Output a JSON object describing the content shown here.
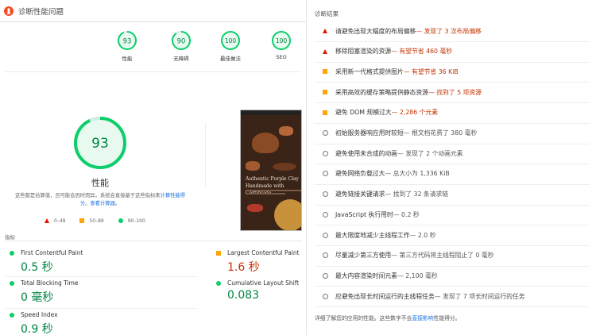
{
  "header": {
    "title": "诊断性能问题"
  },
  "gauges": [
    {
      "score": "93",
      "label": "性能"
    },
    {
      "score": "90",
      "label": "无障碍"
    },
    {
      "score": "100",
      "label": "最佳做法"
    },
    {
      "score": "100",
      "label": "SEO"
    }
  ],
  "performance": {
    "score": "93",
    "title": "性能",
    "desc_prefix": "这些都是估算值，且可能会因时而异。系统会直接基于这些指标来",
    "desc_link1": "计算性能得分",
    "desc_mid": "。",
    "desc_link2": "查看计算器",
    "desc_suffix": "。"
  },
  "legend": [
    {
      "range": "0–49",
      "color": "#eb0f00"
    },
    {
      "range": "50–89",
      "color": "#ffa400"
    },
    {
      "range": "90–100",
      "color": "#0cce6b"
    }
  ],
  "screenshot": {
    "headline": "Authentic Purple Clay Handmade with Certificate"
  },
  "metrics_heading": "指标",
  "metrics": [
    {
      "name": "First Contentful Paint",
      "value": "0.5 秒",
      "status": "good"
    },
    {
      "name": "Largest Contentful Paint",
      "value": "1.6 秒",
      "status": "average"
    },
    {
      "name": "Total Blocking Time",
      "value": "0 毫秒",
      "status": "good"
    },
    {
      "name": "Cumulative Layout Shift",
      "value": "0.083",
      "status": "good"
    },
    {
      "name": "Speed Index",
      "value": "0.9 秒",
      "status": "good"
    }
  ],
  "diagnostics": {
    "title": "诊断结果",
    "items": [
      {
        "icon": "fail",
        "text": "请避免出现大幅度的布局偏移",
        "detail": " — 发现了 3 次布局偏移",
        "detail_color": "red"
      },
      {
        "icon": "fail",
        "text": "移除阻塞渲染的资源",
        "detail": " — 有望节省 460 毫秒",
        "detail_color": "red"
      },
      {
        "icon": "average",
        "text": "采用新一代格式提供图片",
        "detail": " — 有望节省 36 KiB",
        "detail_color": "red"
      },
      {
        "icon": "average",
        "text": "采用高效的缓存策略提供静态资源",
        "detail": " — 找到了 5 项资源",
        "detail_color": "red"
      },
      {
        "icon": "average",
        "text": "避免 DOM 规模过大",
        "detail": " — 2,286 个元素",
        "detail_color": "red"
      },
      {
        "icon": "info",
        "text": "初始服务器响应用时较短",
        "detail": " — 根文档花费了 380 毫秒",
        "detail_color": "gray"
      },
      {
        "icon": "info",
        "text": "避免使用未合成的动画",
        "detail": " — 发现了 2 个动画元素",
        "detail_color": "gray"
      },
      {
        "icon": "info",
        "text": "避免网络负载过大",
        "detail": " — 总大小为 1,336 KiB",
        "detail_color": "gray"
      },
      {
        "icon": "info",
        "text": "避免链接关键请求",
        "detail": " — 找到了 32 条请求链",
        "detail_color": "gray"
      },
      {
        "icon": "info",
        "text": "JavaScript 执行用时",
        "detail": " — 0.2 秒",
        "detail_color": "gray"
      },
      {
        "icon": "info",
        "text": "最大限度地减少主线程工作",
        "detail": " — 2.0 秒",
        "detail_color": "gray"
      },
      {
        "icon": "info",
        "text": "尽量减少第三方使用",
        "detail": " — 第三方代码将主线程阻止了 0 毫秒",
        "detail_color": "gray"
      },
      {
        "icon": "info",
        "text": "最大内容渲染时间元素",
        "detail": " — 2,100 毫秒",
        "detail_color": "gray"
      },
      {
        "icon": "info",
        "text": "应避免出现长时间运行的主线程任务",
        "detail": " — 发现了 7 项长时间运行的任务",
        "detail_color": "gray"
      }
    ],
    "footnote_prefix": "详细了解您的应用的性能。这些数字不会",
    "footnote_link": "直接影响",
    "footnote_suffix": "性能得分。"
  },
  "colors": {
    "good": "#0cce6b",
    "average": "#ffa400",
    "fail": "#eb0f00",
    "good_text": "#018642",
    "average_text": "#c33300"
  }
}
